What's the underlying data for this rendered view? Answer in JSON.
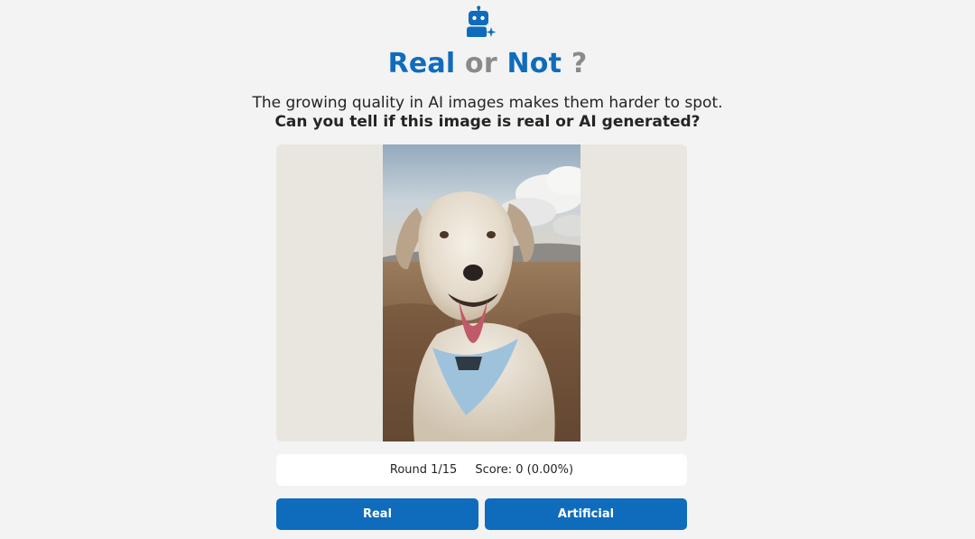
{
  "header": {
    "logo_icon": "robot-sparkle-icon",
    "title_part1": "Real",
    "title_part2": "or",
    "title_part3": "Not",
    "title_part4": "?",
    "subtitle": "The growing quality in AI images makes them harder to spot.",
    "question": "Can you tell if this image is real or AI generated?"
  },
  "image": {
    "alt": "dog-photo"
  },
  "status": {
    "round": "Round 1/15",
    "score": "Score: 0 (0.00%)"
  },
  "buttons": {
    "real_label": "Real",
    "artificial_label": "Artificial"
  },
  "colors": {
    "accent": "#0f6cbd",
    "muted": "#8a8a8a",
    "background": "#f3f3f3",
    "frame": "#e9e6e0"
  }
}
